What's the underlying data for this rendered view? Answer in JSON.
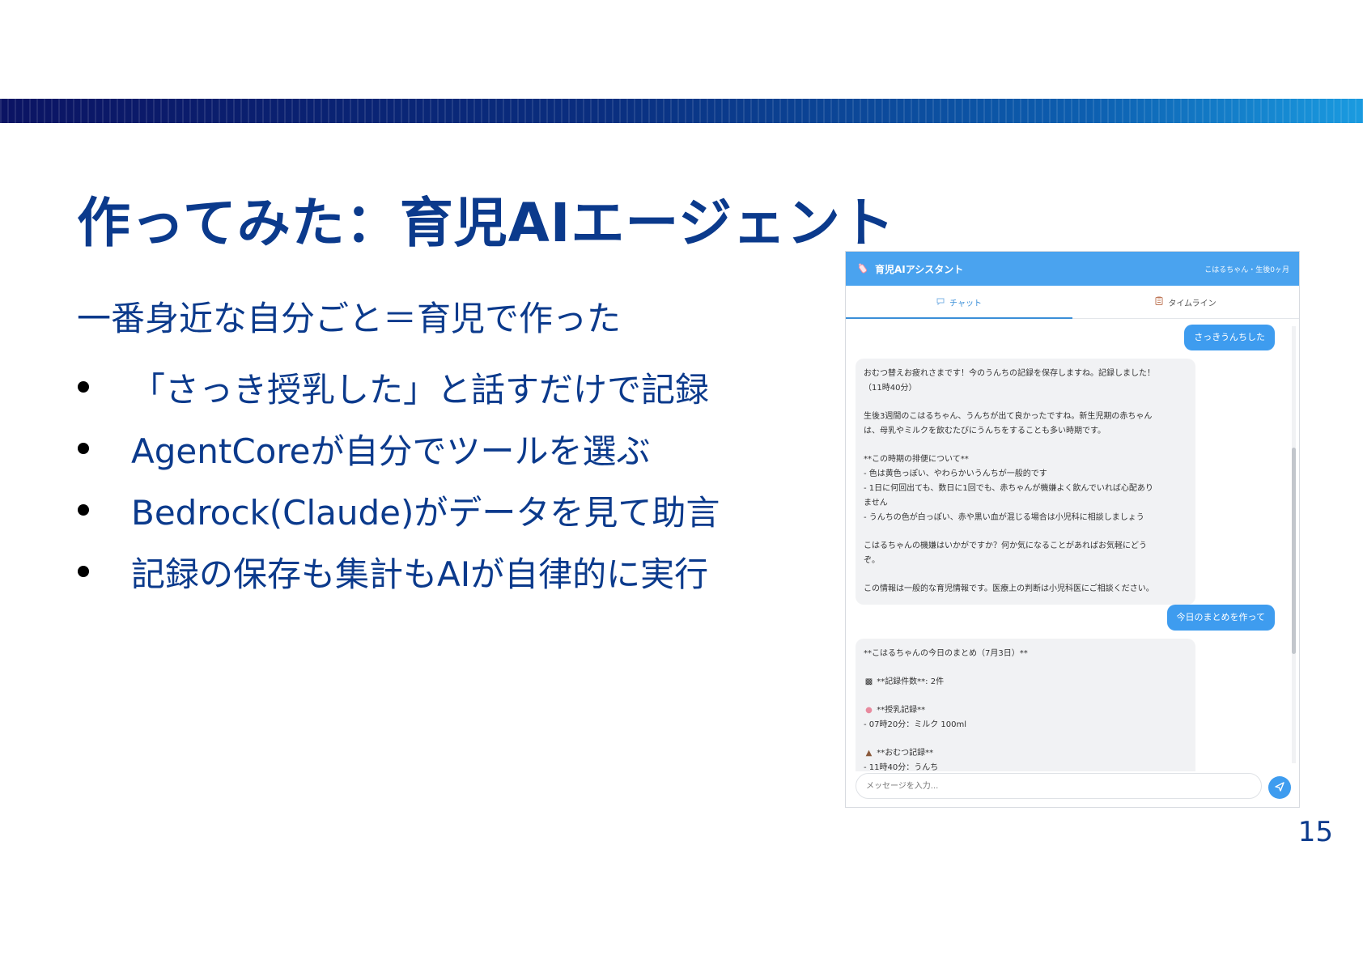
{
  "slide": {
    "title": "作ってみた：育児AIエージェント",
    "subtitle": "一番身近な自分ごと＝育児で作った",
    "bullets": [
      "「さっき授乳した」と話すだけで記録",
      "AgentCoreが自分でツールを選ぶ",
      "Bedrock(Claude)がデータを見て助言",
      "記録の保存も集計もAIが自律的に実行"
    ],
    "page_number": "15",
    "band_colors": [
      "#0b1463",
      "#1a9be0"
    ],
    "text_color": "#0b3a8c"
  },
  "app": {
    "header": {
      "title": "育児AIアシスタント",
      "child_info": "こはるちゃん・生後0ヶ月",
      "icon": "baby-bottle-icon",
      "color": "#4aa3ef"
    },
    "tabs": [
      {
        "label": "チャット",
        "icon": "chat-icon",
        "active": true
      },
      {
        "label": "タイムライン",
        "icon": "clipboard-icon",
        "active": false
      }
    ],
    "messages": {
      "user_1": "さっきうんちした",
      "ai_1": {
        "lines": [
          "おむつ替えお疲れさまです！今のうんちの記録を保存しますね。記録しました！",
          "（11時40分）",
          "",
          "生後3週間のこはるちゃん、うんちが出て良かったですね。新生児期の赤ちゃん",
          "は、母乳やミルクを飲むたびにうんちをすることも多い時期です。",
          "",
          "**この時期の排便について**",
          "- 色は黄色っぽい、やわらかいうんちが一般的です",
          "- 1日に何回出ても、数日に1回でも、赤ちゃんが機嫌よく飲んでいれば心配あり",
          "ません",
          "- うんちの色が白っぽい、赤や黒い血が混じる場合は小児科に相談しましょう",
          "",
          "こはるちゃんの機嫌はいかがですか？何か気になることがあればお気軽にどう",
          "ぞ。",
          "",
          "この情報は一般的な育児情報です。医療上の判断は小児科医にご相談ください。"
        ]
      },
      "user_2": "今日のまとめを作って",
      "ai_2": {
        "summary_title": "**こはるちゃんの今日のまとめ（7月3日）**",
        "count_line": "**記録件数**: 2件",
        "feeding_header": "**授乳記録**",
        "feeding_line": "- 07時20分：ミルク 100ml",
        "diaper_header": "**おむつ記録**",
        "diaper_line": "- 11時40分：うんち",
        "icons": [
          "clipboard-icon",
          "baby-bottle-icon",
          "poop-icon"
        ]
      }
    },
    "input": {
      "placeholder": "メッセージを入力..."
    },
    "accent_color": "#3e9cef"
  }
}
